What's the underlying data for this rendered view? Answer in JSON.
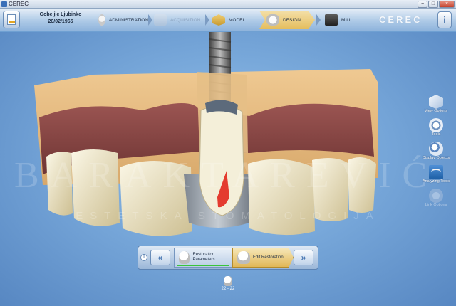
{
  "window": {
    "title": "CEREC",
    "buttons": {
      "minimize": "−",
      "maximize": "□",
      "close": "×"
    }
  },
  "header": {
    "patient_name": "Gobeljic Ljubinko",
    "patient_dob": "20/02/1965",
    "steps": [
      {
        "label": "ADMINISTRATION",
        "icon": "administration-icon",
        "state": "normal"
      },
      {
        "label": "ACQUISITION",
        "icon": "acquisition-icon",
        "state": "disabled"
      },
      {
        "label": "MODEL",
        "icon": "model-icon",
        "state": "normal"
      },
      {
        "label": "DESIGN",
        "icon": "design-icon",
        "state": "active"
      },
      {
        "label": "MILL",
        "icon": "mill-icon",
        "state": "normal"
      }
    ],
    "brand": "CEREC",
    "help_icon": "help-icon"
  },
  "watermark": {
    "line1": "BARAKTAREVIĆ",
    "line2": "ESTETSKA STOMATOLOGIJA"
  },
  "toolbar": {
    "items": [
      {
        "label": "View Options",
        "icon": "cube-view-icon",
        "enabled": true
      },
      {
        "label": "Tools",
        "icon": "tools-icon",
        "enabled": true
      },
      {
        "label": "Display Objects",
        "icon": "display-objects-icon",
        "enabled": true
      },
      {
        "label": "Analyzing Tools",
        "icon": "analyzing-tools-icon",
        "enabled": true
      },
      {
        "label": "Link Options",
        "icon": "link-options-icon",
        "enabled": false
      }
    ]
  },
  "nav": {
    "info": "i",
    "prev": "«",
    "next": "»",
    "stages": [
      {
        "label": "Restoration Parameters",
        "state": "done"
      },
      {
        "label": "Edit Restoration",
        "state": "active"
      }
    ]
  },
  "tooth_selector": {
    "label": "22 - 22"
  },
  "colors": {
    "viewport_bg": "#78a8da",
    "active_step": "#e4bd5d",
    "progress": "#39c43b",
    "model_base": "#e3b97e",
    "gingiva": "#8a4a47",
    "restoration_red": "#e43b2f"
  }
}
